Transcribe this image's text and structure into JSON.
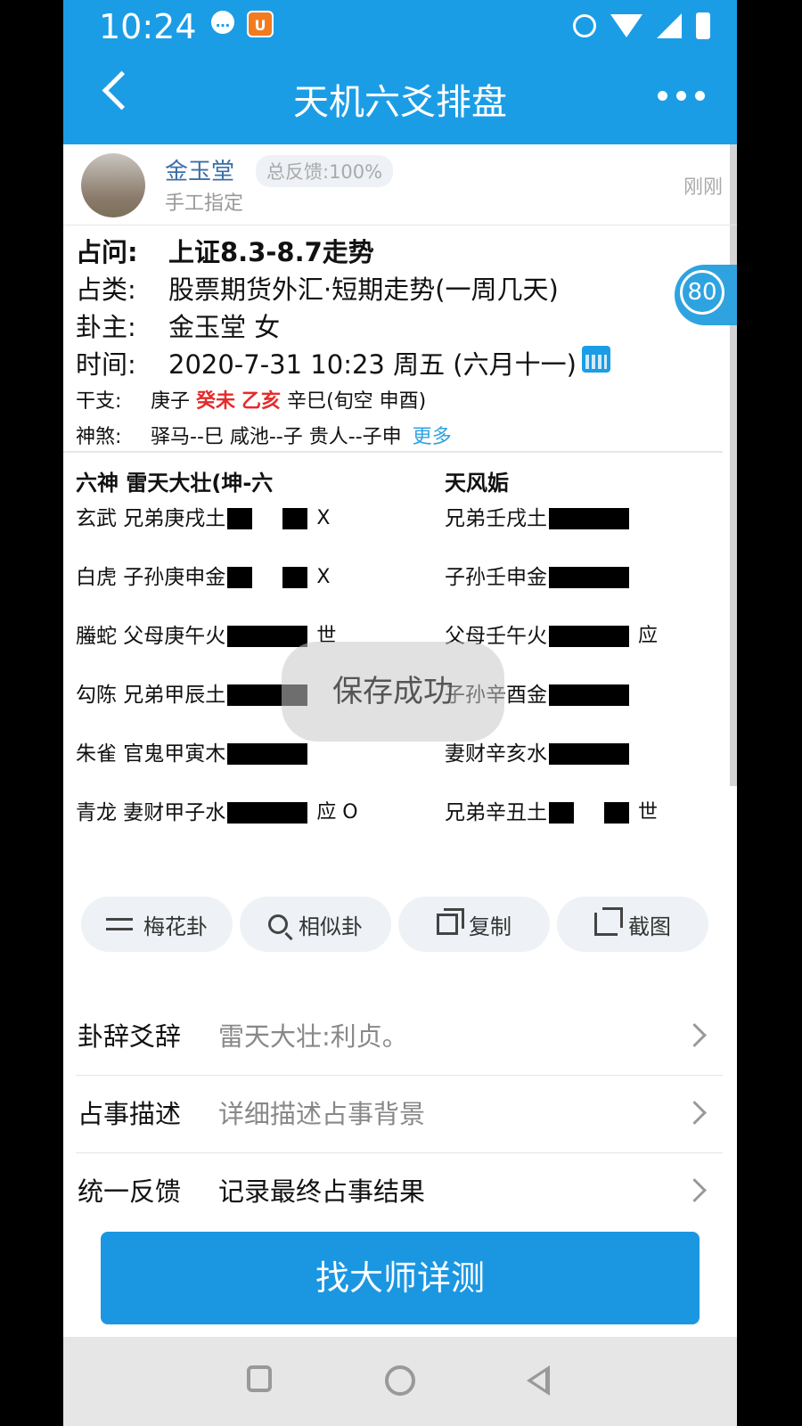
{
  "status_bar": {
    "time": "10:24"
  },
  "nav": {
    "title": "天机六爻排盘"
  },
  "author": {
    "name": "金玉堂",
    "feedback": "总反馈:100%",
    "sub": "手工指定",
    "time": "刚刚"
  },
  "score": "80",
  "info": {
    "question": {
      "k": "占问:",
      "v": "上证8.3-8.7走势"
    },
    "category": {
      "k": "占类:",
      "v": "股票期货外汇·短期走势(一周几天)"
    },
    "owner": {
      "k": "卦主:",
      "v": "金玉堂 女"
    },
    "time": {
      "k": "时间:",
      "v": "2020-7-31 10:23 周五 (六月十一)"
    },
    "ganzhi": {
      "k": "干支:",
      "year": "庚子",
      "month": "癸未",
      "day": "乙亥",
      "hour": "辛巳",
      "void": "(旬空 申酉)"
    },
    "shensha": {
      "k": "神煞:",
      "v": "驿马--巳  咸池--子  贵人--子申",
      "more": "更多"
    }
  },
  "gua": {
    "header_left": "六神  雷天大壮(坤-六",
    "header_right": "天风姤",
    "rows": [
      {
        "left": "玄武 兄弟庚戌土",
        "left_line": "yin",
        "left_mark": "X",
        "right": "兄弟壬戌土",
        "right_line": "yang",
        "right_mark": ""
      },
      {
        "left": "白虎 子孙庚申金",
        "left_line": "yin",
        "left_mark": "X",
        "right": "子孙壬申金",
        "right_line": "yang",
        "right_mark": ""
      },
      {
        "left": "螣蛇 父母庚午火",
        "left_line": "yang",
        "left_mark": "世",
        "right": "父母壬午火",
        "right_line": "yang",
        "right_mark": "应"
      },
      {
        "left": "勾陈 兄弟甲辰土",
        "left_line": "yang",
        "left_mark": "",
        "right": "子孙辛酉金",
        "right_line": "yang",
        "right_mark": ""
      },
      {
        "left": "朱雀 官鬼甲寅木",
        "left_line": "yang",
        "left_mark": "",
        "right": "妻财辛亥水",
        "right_line": "yang",
        "right_mark": ""
      },
      {
        "left": "青龙 妻财甲子水",
        "left_line": "yang",
        "left_mark": "应 O",
        "right": "兄弟辛丑土",
        "right_line": "yin",
        "right_mark": "世"
      }
    ]
  },
  "toast": "保存成功",
  "actions": [
    {
      "label": "梅花卦",
      "icon": "swap-icon"
    },
    {
      "label": "相似卦",
      "icon": "search-icon"
    },
    {
      "label": "复制",
      "icon": "copy-icon"
    },
    {
      "label": "截图",
      "icon": "crop-icon"
    }
  ],
  "details": [
    {
      "k": "卦辞爻辞",
      "v": "雷天大壮:利贞。",
      "grey": true
    },
    {
      "k": "占事描述",
      "v": "详细描述占事背景",
      "grey": true
    },
    {
      "k": "统一反馈",
      "v": "记录最终占事结果",
      "grey": false
    }
  ],
  "cta": "找大师详测"
}
